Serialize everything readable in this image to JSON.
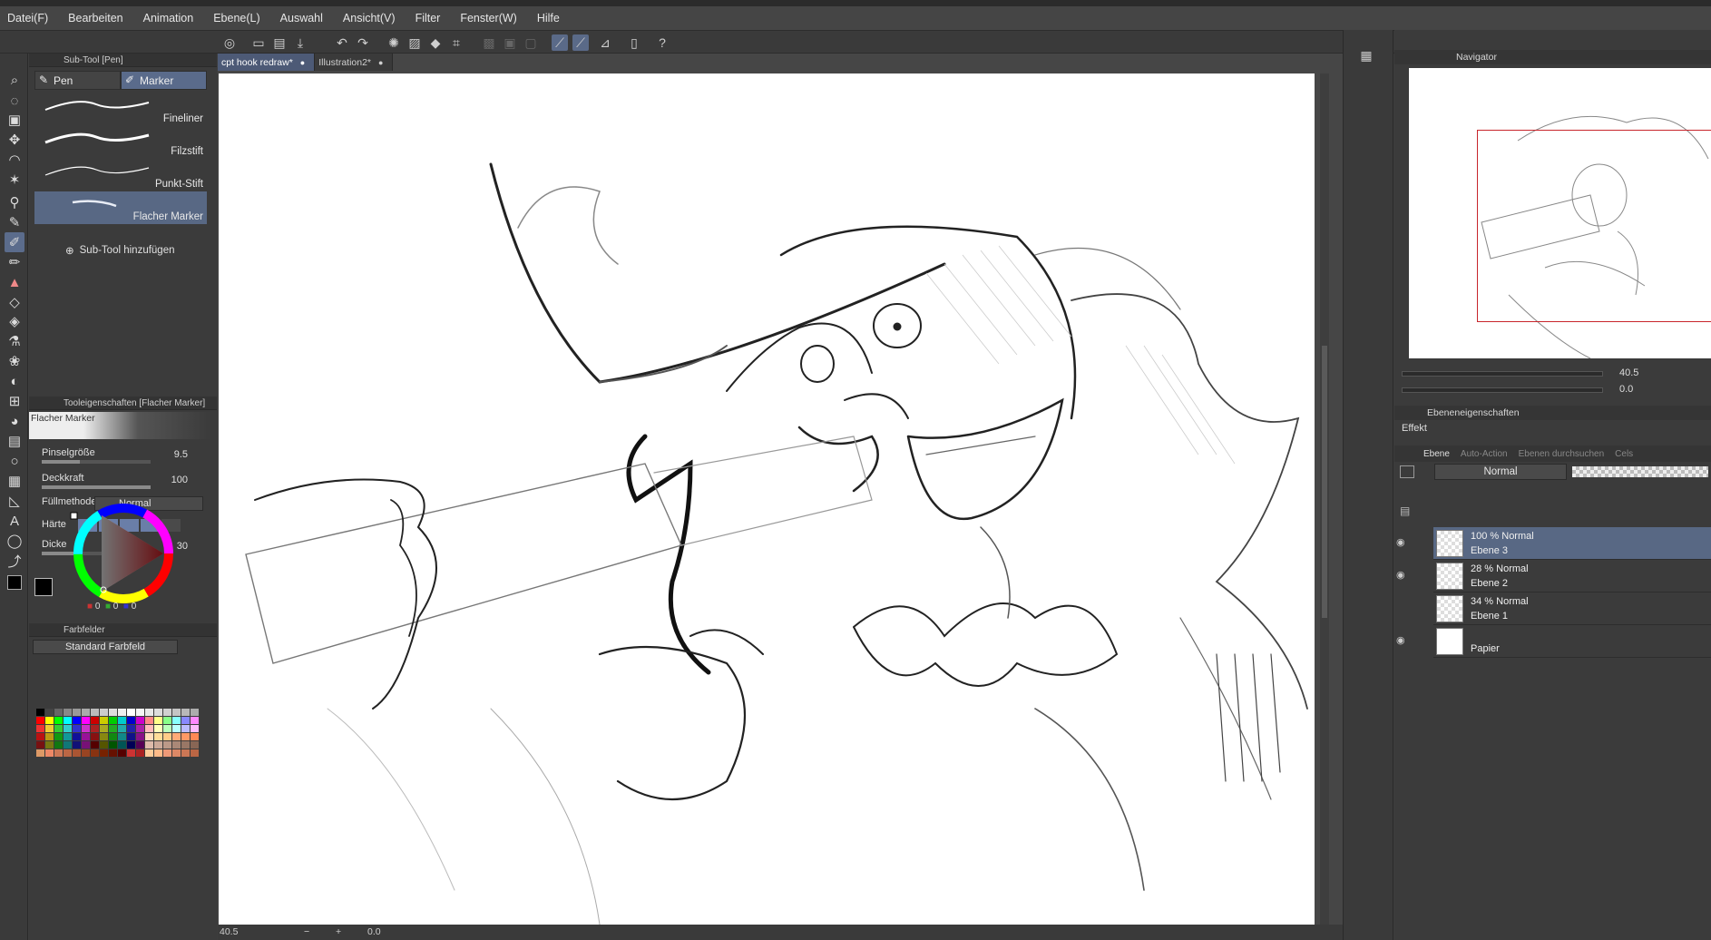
{
  "menu": [
    "Datei(F)",
    "Bearbeiten",
    "Animation",
    "Ebene(L)",
    "Auswahl",
    "Ansicht(V)",
    "Filter",
    "Fenster(W)",
    "Hilfe"
  ],
  "subtool_panel": {
    "title": "Sub-Tool [Pen]",
    "tabs": [
      "Pen",
      "Marker"
    ],
    "brushes": [
      "Fineliner",
      "Filzstift",
      "Punkt-Stift",
      "Flacher Marker"
    ],
    "add_label": "Sub-Tool hinzufügen"
  },
  "tool_props": {
    "title": "Tooleigenschaften [Flacher Marker]",
    "preview_label": "Flacher Marker",
    "brush_size_label": "Pinselgröße",
    "brush_size": "9.5",
    "opacity_label": "Deckkraft",
    "opacity": "100",
    "fill_mode_label": "Füllmethode",
    "fill_mode": "Normal",
    "hardness_label": "Härte",
    "thickness_label": "Dicke",
    "thickness": "30"
  },
  "color": {
    "r": "0",
    "g": "0",
    "b": "0"
  },
  "swatches": {
    "title": "Farbfelder",
    "set": "Standard Farbfeld"
  },
  "documents": [
    {
      "name": "cpt hook redraw*"
    },
    {
      "name": "Illustration2*"
    }
  ],
  "status": {
    "zoom": "40.5",
    "rotation": "0.0"
  },
  "navigator": {
    "title": "Navigator",
    "zoom": "40.5",
    "rotation": "0.0"
  },
  "layer_props": {
    "title": "Ebeneneigenschaften",
    "effekt": "Effekt"
  },
  "layer_panel": {
    "tabs": [
      "Ebene",
      "Auto-Action",
      "Ebenen durchsuchen",
      "Cels"
    ],
    "blend_mode": "Normal",
    "layers": [
      {
        "line1": "100 % Normal",
        "line2": "Ebene 3",
        "visible": true
      },
      {
        "line1": "28 % Normal",
        "line2": "Ebene 2",
        "visible": true
      },
      {
        "line1": "34 % Normal",
        "line2": "Ebene 1",
        "visible": false
      },
      {
        "line1": "",
        "line2": "Papier",
        "visible": true
      }
    ]
  }
}
